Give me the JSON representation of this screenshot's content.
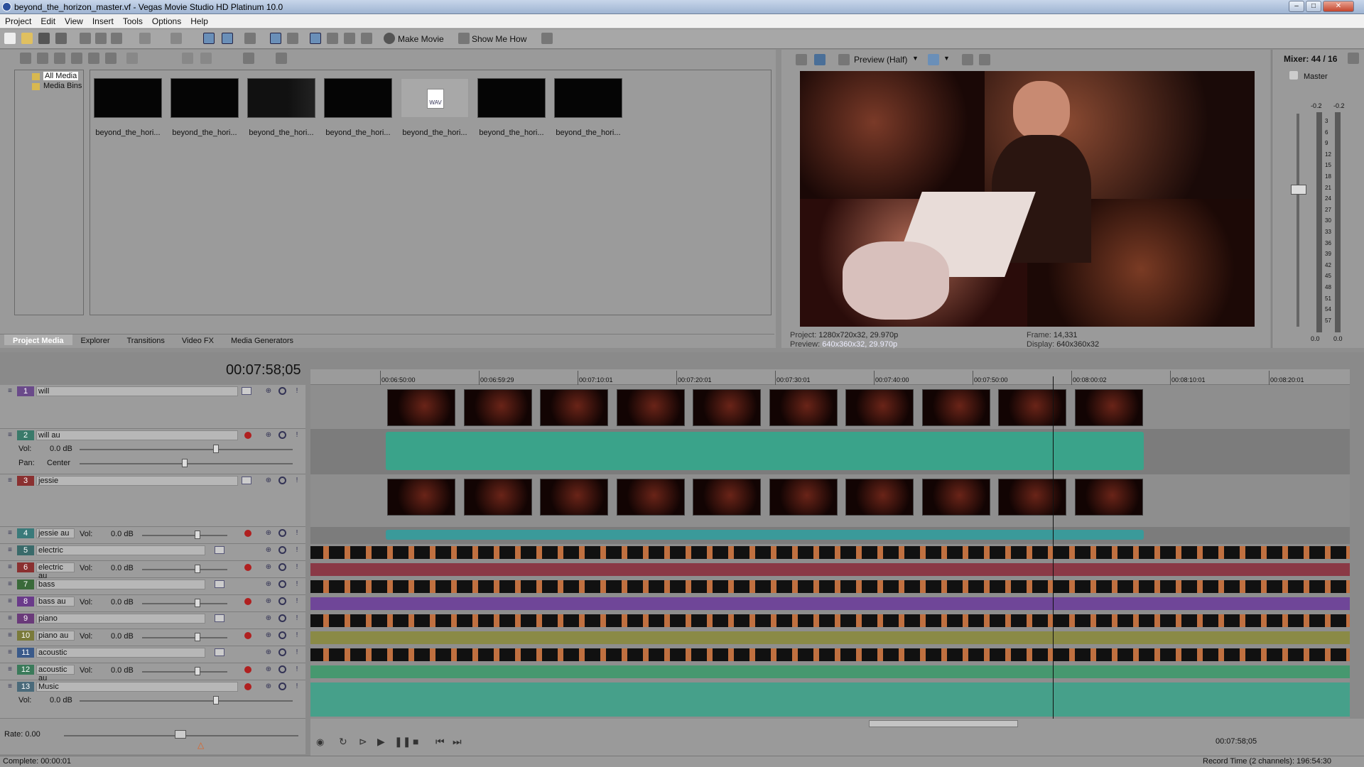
{
  "window": {
    "title": "beyond_the_horizon_master.vf - Vegas Movie Studio HD Platinum 10.0"
  },
  "menu": [
    "Project",
    "Edit",
    "View",
    "Insert",
    "Tools",
    "Options",
    "Help"
  ],
  "toolbar": {
    "make_movie": "Make Movie",
    "show_me_how": "Show Me How"
  },
  "media_tree": {
    "items": [
      "All Media",
      "Media Bins"
    ]
  },
  "media": {
    "thumb_labels": [
      "beyond_the_hori...",
      "beyond_the_hori...",
      "beyond_the_hori...",
      "beyond_the_hori...",
      "beyond_the_hori...",
      "beyond_the_hori...",
      "beyond_the_hori..."
    ],
    "wav_badge": "WAV"
  },
  "tabs": [
    "Project Media",
    "Explorer",
    "Transitions",
    "Video FX",
    "Media Generators"
  ],
  "preview": {
    "mode": "Preview (Half)",
    "project_label": "Project:",
    "project_value": "1280x720x32, 29.970p",
    "preview_label": "Preview:",
    "preview_value": "640x360x32, 29.970p",
    "frame_label": "Frame:",
    "frame_value": "14,331",
    "display_label": "Display:",
    "display_value": "640x360x32"
  },
  "mixer": {
    "title": "Mixer: 44 / 16",
    "master": "Master",
    "scale": [
      "-0.2",
      "-0.2",
      "3",
      "6",
      "9",
      "12",
      "15",
      "18",
      "21",
      "24",
      "27",
      "30",
      "33",
      "36",
      "39",
      "42",
      "45",
      "48",
      "51",
      "54",
      "57"
    ],
    "bottom": "0.0"
  },
  "timeline": {
    "timecode": "00:07:58;05",
    "ruler": [
      "00:06:50:00",
      "00:06:59:29",
      "00:07:10:01",
      "00:07:20:01",
      "00:07:30:01",
      "00:07:40:00",
      "00:07:50:00",
      "00:08:00:02",
      "00:08:10:01",
      "00:08:20:01"
    ],
    "vol_label": "Vol:",
    "pan_label": "Pan:",
    "pan_value": "Center",
    "vol_value": "0.0 dB"
  },
  "tracks": [
    {
      "num": "1",
      "name": "will",
      "color": "#6a4a8a"
    },
    {
      "num": "2",
      "name": "will au",
      "color": "#3a7a6a"
    },
    {
      "num": "3",
      "name": "jessie",
      "color": "#8a3030"
    },
    {
      "num": "4",
      "name": "jessie au",
      "color": "#3a7a7a"
    },
    {
      "num": "5",
      "name": "electric",
      "color": "#3a6a6a"
    },
    {
      "num": "6",
      "name": "electric au",
      "color": "#8a3030"
    },
    {
      "num": "7",
      "name": "bass",
      "color": "#3a6a3a"
    },
    {
      "num": "8",
      "name": "bass au",
      "color": "#6a3a8a"
    },
    {
      "num": "9",
      "name": "piano",
      "color": "#6a3a7a"
    },
    {
      "num": "10",
      "name": "piano au",
      "color": "#7a7a3a"
    },
    {
      "num": "11",
      "name": "acoustic",
      "color": "#3a5a8a"
    },
    {
      "num": "12",
      "name": "acoustic au",
      "color": "#3a7a5a"
    },
    {
      "num": "13",
      "name": "Music",
      "color": "#4a6a7a"
    }
  ],
  "transport": {
    "rate": "Rate: 0.00",
    "timecode": "00:07:58;05"
  },
  "status": {
    "complete": "Complete: 00:00:01",
    "record": "Record Time (2 channels): 196:54:30"
  }
}
